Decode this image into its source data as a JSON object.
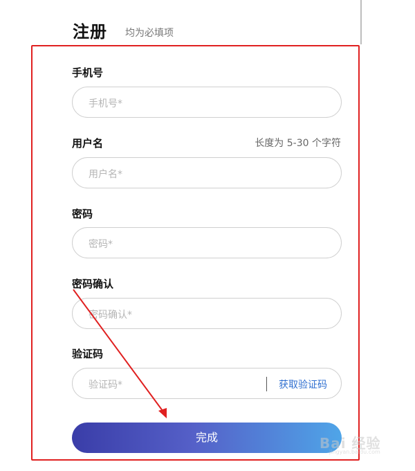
{
  "header": {
    "title": "注册",
    "subtitle": "均为必填项"
  },
  "form": {
    "phone": {
      "label": "手机号",
      "placeholder": "手机号*"
    },
    "username": {
      "label": "用户名",
      "hint": "长度为 5-30 个字符",
      "placeholder": "用户名*"
    },
    "password": {
      "label": "密码",
      "placeholder": "密码*"
    },
    "password_confirm": {
      "label": "密码确认",
      "placeholder": "密码确认*"
    },
    "verify_code": {
      "label": "验证码",
      "placeholder": "验证码*",
      "get_code_label": "获取验证码"
    },
    "submit_label": "完成"
  },
  "annotation": {
    "highlight_color": "#e02020"
  },
  "watermark": {
    "text": "Bai 经验",
    "sub": "jingyan.baidu.com"
  },
  "colors": {
    "button_gradient_start": "#3a3da8",
    "button_gradient_end": "#4fa5e8",
    "link": "#2f6fd0"
  }
}
